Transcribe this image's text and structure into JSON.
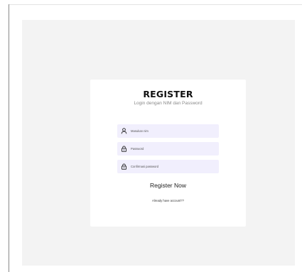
{
  "register": {
    "title": "REGISTER",
    "subtitle": "Login dengan NIM dan Password",
    "fields": [
      {
        "placeholder": "Masukan nim",
        "icon": "user-icon"
      },
      {
        "placeholder": "Password",
        "icon": "lock-icon"
      },
      {
        "placeholder": "Confirmasi password",
        "icon": "lock-icon"
      }
    ],
    "submit_label": "Register Now",
    "login_link": "Already have account??"
  },
  "colors": {
    "page_background": "#f3f3f3",
    "card_background": "#ffffff",
    "field_background": "#f1effd",
    "title_text": "#111111",
    "subtitle_text": "#8a8a8a"
  }
}
